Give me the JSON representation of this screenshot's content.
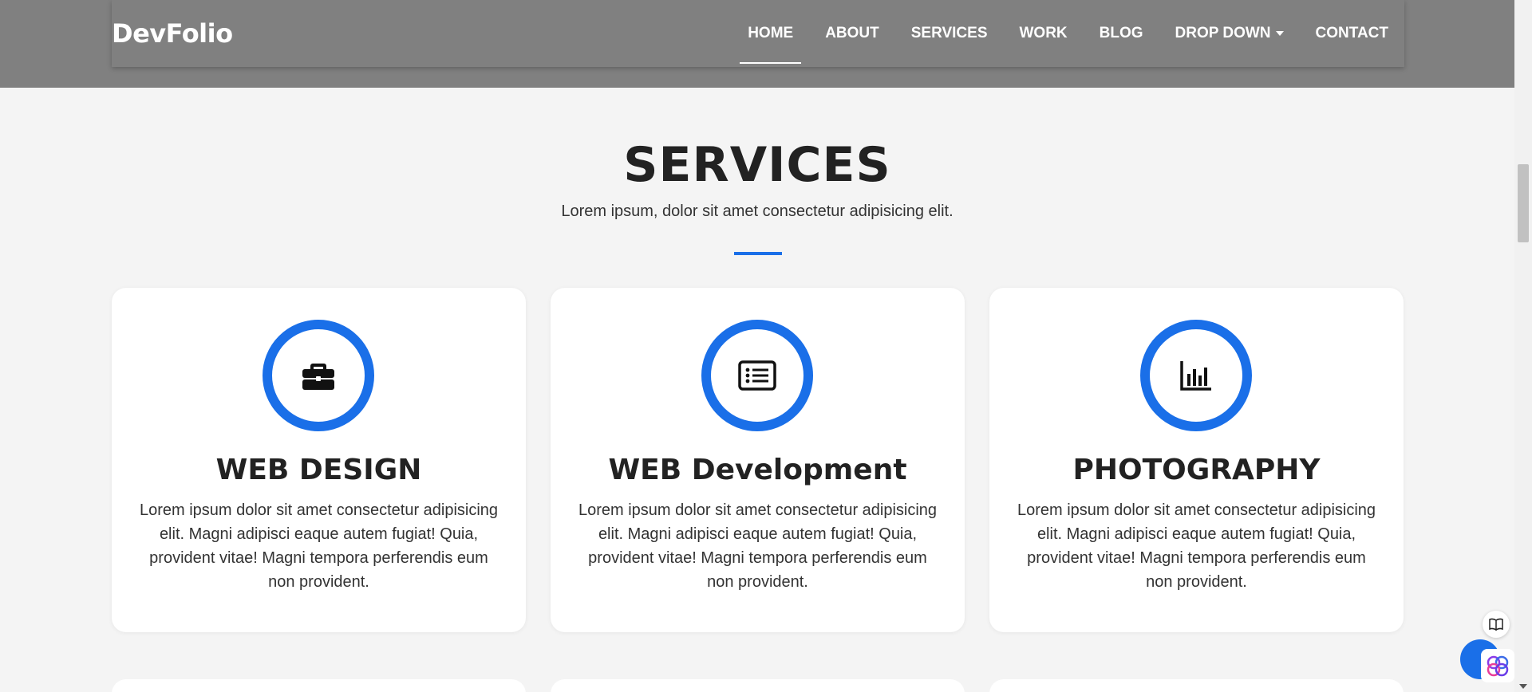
{
  "header": {
    "brand": "DevFolio",
    "nav": [
      {
        "label": "HOME",
        "active": true
      },
      {
        "label": "ABOUT"
      },
      {
        "label": "SERVICES"
      },
      {
        "label": "WORK"
      },
      {
        "label": "BLOG"
      },
      {
        "label": "DROP DOWN",
        "has_caret": true
      },
      {
        "label": "CONTACT"
      }
    ]
  },
  "section": {
    "title": "SERVICES",
    "subtitle": "Lorem ipsum, dolor sit amet consectetur adipisicing elit."
  },
  "cards": [
    {
      "icon": "briefcase-icon",
      "title": "WEB DESIGN",
      "text": "Lorem ipsum dolor sit amet consectetur adipisicing elit. Magni adipisci eaque autem fugiat! Quia, provident vitae! Magni tempora perferendis eum non provident."
    },
    {
      "icon": "card-list-icon",
      "title": "WEB Development",
      "text": "Lorem ipsum dolor sit amet consectetur adipisicing elit. Magni adipisci eaque autem fugiat! Quia, provident vitae! Magni tempora perferendis eum non provident."
    },
    {
      "icon": "bar-chart-icon",
      "title": "PHOTOGRAPHY",
      "text": "Lorem ipsum dolor sit amet consectetur adipisicing elit. Magni adipisci eaque autem fugiat! Quia, provident vitae! Magni tempora perferendis eum non provident."
    }
  ],
  "colors": {
    "accent": "#1a6fe8",
    "header_bg": "#808080",
    "page_bg": "#f4f4f4"
  }
}
